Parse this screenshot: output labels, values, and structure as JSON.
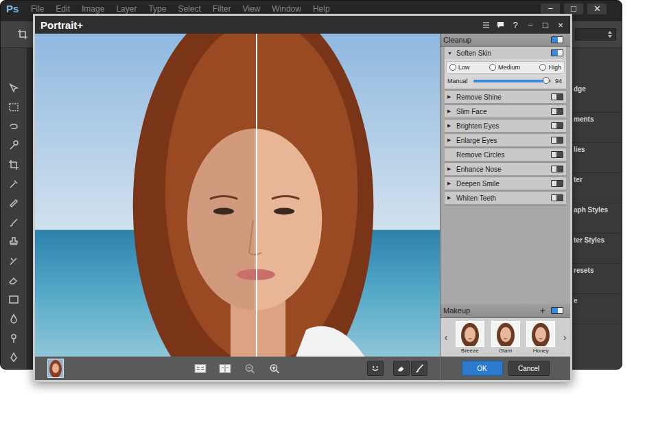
{
  "photoshop": {
    "logo": "Ps",
    "menu": [
      "File",
      "Edit",
      "Image",
      "Layer",
      "Type",
      "Select",
      "Filter",
      "View",
      "Window",
      "Help"
    ],
    "window_controls": [
      "−",
      "□",
      "✕"
    ],
    "panel_items": [
      "dge",
      "ments",
      "lies",
      "ter",
      "aph Styles",
      "ter Styles",
      "resets",
      "e"
    ]
  },
  "window": {
    "title": "Portrait+",
    "title_controls": [
      "?",
      "−",
      "□",
      "×"
    ]
  },
  "cleanup": {
    "title": "Cleanup",
    "on": true,
    "arrow_expanded": "▼",
    "arrow_collapsed": "▶",
    "items": [
      {
        "label": "Soften Skin",
        "kind": "expandable",
        "expanded": true,
        "on": true,
        "options": [
          {
            "label": "Low",
            "selected": false
          },
          {
            "label": "Medium",
            "selected": false
          },
          {
            "label": "High",
            "selected": false
          }
        ],
        "slider": {
          "label": "Manual",
          "level": 0.94,
          "reading": "94"
        }
      },
      {
        "label": "Remove Shine",
        "kind": "expandable",
        "expanded": false,
        "on": false
      },
      {
        "label": "Slim Face",
        "kind": "expandable",
        "expanded": false,
        "on": false
      },
      {
        "label": "Brighten Eyes",
        "kind": "expandable",
        "expanded": false,
        "on": false
      },
      {
        "label": "Enlarge Eyes",
        "kind": "expandable",
        "expanded": false,
        "on": false
      },
      {
        "label": "Remove Circles",
        "kind": "plain",
        "expanded": false,
        "on": false
      },
      {
        "label": "Enhance Nose",
        "kind": "expandable",
        "expanded": false,
        "on": false
      },
      {
        "label": "Deepen Smile",
        "kind": "expandable",
        "expanded": false,
        "on": false
      },
      {
        "label": "Whiten Teeth",
        "kind": "expandable",
        "expanded": false,
        "on": false
      }
    ]
  },
  "makeup": {
    "title": "Makeup",
    "add": "+",
    "on": true,
    "prev": "‹",
    "next": "›",
    "presets": [
      {
        "name": "Breeze",
        "selected": false
      },
      {
        "name": "Glam",
        "selected": false
      },
      {
        "name": "Honey",
        "selected": false
      }
    ]
  },
  "buttons": [
    {
      "label": "OK",
      "primary": true
    },
    {
      "label": "Cancel",
      "primary": false
    }
  ]
}
